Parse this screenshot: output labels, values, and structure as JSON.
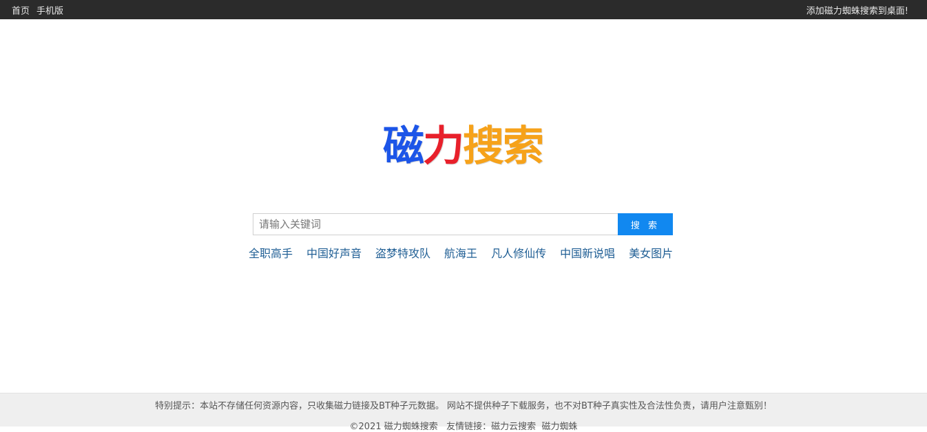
{
  "topbar": {
    "nav": [
      {
        "label": "首页"
      },
      {
        "label": "手机版"
      }
    ],
    "right_link": "添加磁力蜘蛛搜索到桌面!"
  },
  "logo": {
    "chars": [
      "磁",
      "力",
      "搜",
      "索"
    ],
    "colors": {
      "blue": "#1c55e8",
      "red": "#e8202b",
      "orange": "#f6a21a"
    }
  },
  "search": {
    "placeholder": "请输入关键词",
    "value": "",
    "button_label": "搜 索",
    "button_color": "#1188f0"
  },
  "hotwords": [
    "全职高手",
    "中国好声音",
    "盗梦特攻队",
    "航海王",
    "凡人修仙传",
    "中国新说唱",
    "美女图片"
  ],
  "footer": {
    "notice": "特别提示：本站不存储任何资源内容，只收集磁力链接及BT种子元数据。 网站不提供种子下载服务，也不对BT种子真实性及合法性负责，请用户注意甄别！",
    "copyright": "©2021 磁力蜘蛛搜索",
    "links_label": "友情链接：",
    "links": [
      "磁力云搜索",
      "磁力蜘蛛"
    ]
  }
}
